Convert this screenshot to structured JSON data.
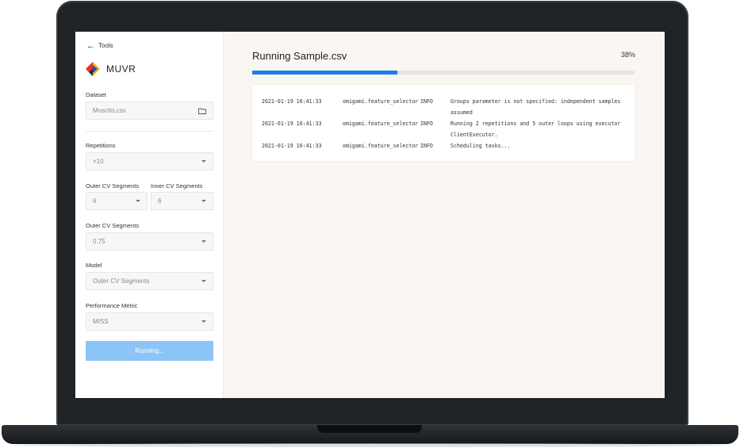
{
  "sidebar": {
    "back_label": "Tools",
    "brand_name": "MUVR",
    "dataset": {
      "label": "Dataset",
      "value": "Moscito.csv"
    },
    "repetitions": {
      "label": "Repetitions",
      "value": "×10"
    },
    "outer_cv": {
      "label": "Outer CV Segments",
      "value": "6"
    },
    "inner_cv": {
      "label": "Inner CV Segments",
      "value": "6"
    },
    "outer_cv_2": {
      "label": "Outer CV Segments",
      "value": "0.75"
    },
    "model": {
      "label": "Model",
      "value": "Outer CV Segments"
    },
    "metric": {
      "label": "Performance Metric",
      "value": "MISS"
    },
    "run_button": "Running..."
  },
  "main": {
    "title": "Running Sample.csv",
    "progress_percent": 38,
    "progress_label": "38%",
    "log": [
      {
        "ts": "2021-01-19 16:41:33",
        "src": "omigami.feature_selector",
        "level": "INFO",
        "msg": "Groups parameter is not specified: independent samples assumed"
      },
      {
        "ts": "2021-01-19 16:41:33",
        "src": "omigami.feature_selector",
        "level": "INFO",
        "msg": "Running 2 repetitions and 5 outer loops using executor ClientExecutor."
      },
      {
        "ts": "2021-01-19 16:41:33",
        "src": "omigami.feature_selector",
        "level": "INFO",
        "msg": "Scheduling tasks..."
      }
    ]
  },
  "colors": {
    "accent": "#1a7fe8",
    "button": "#8cc4f7"
  }
}
